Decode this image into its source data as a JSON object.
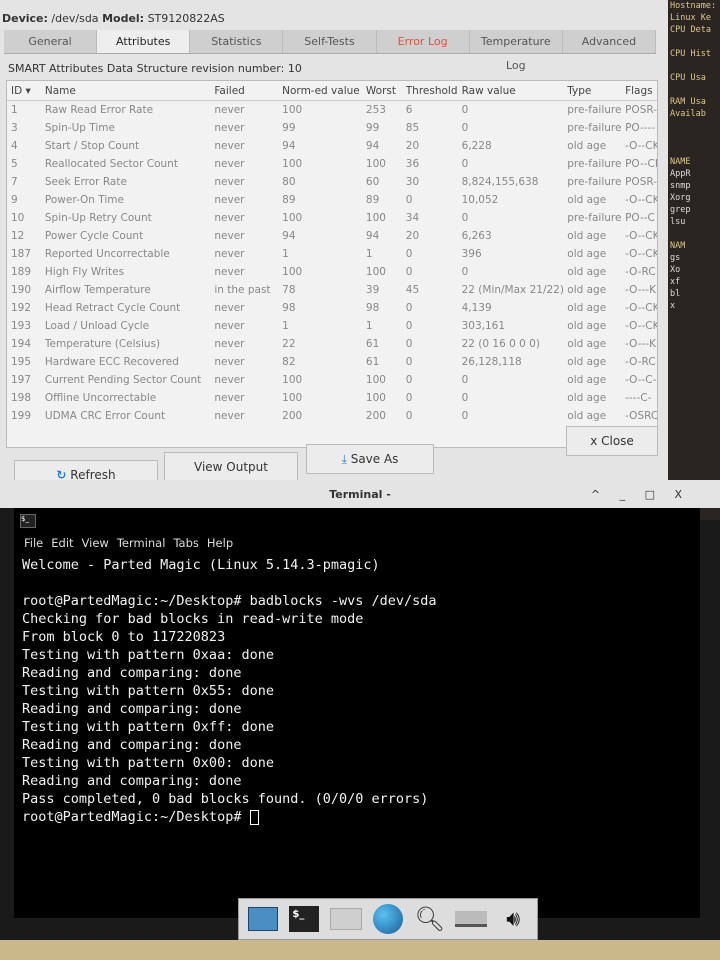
{
  "device": {
    "label": "Device:",
    "value": "/dev/sda",
    "model_label": "Model:",
    "model": "ST9120822AS"
  },
  "tabs": [
    "General",
    "Attributes",
    "Statistics",
    "Self-Tests",
    "Error Log",
    "Temperature Log",
    "Advanced"
  ],
  "revision": "SMART Attributes Data Structure revision number: 10",
  "columns": [
    "ID ▾",
    "Name",
    "Failed",
    "Norm-ed value",
    "Worst",
    "Threshold",
    "Raw value",
    "Type",
    "Flags"
  ],
  "rows": [
    [
      "1",
      "Raw Read Error Rate",
      "never",
      "100",
      "253",
      "6",
      "0",
      "pre-failure",
      "POSR-"
    ],
    [
      "3",
      "Spin-Up Time",
      "never",
      "99",
      "99",
      "85",
      "0",
      "pre-failure",
      "PO----"
    ],
    [
      "4",
      "Start / Stop Count",
      "never",
      "94",
      "94",
      "20",
      "6,228",
      "old age",
      "-O--CK"
    ],
    [
      "5",
      "Reallocated Sector Count",
      "never",
      "100",
      "100",
      "36",
      "0",
      "pre-failure",
      "PO--CK"
    ],
    [
      "7",
      "Seek Error Rate",
      "never",
      "80",
      "60",
      "30",
      "8,824,155,638",
      "pre-failure",
      "POSR-"
    ],
    [
      "9",
      "Power-On Time",
      "never",
      "89",
      "89",
      "0",
      "10,052",
      "old age",
      "-O--CK"
    ],
    [
      "10",
      "Spin-Up Retry Count",
      "never",
      "100",
      "100",
      "34",
      "0",
      "pre-failure",
      "PO--C"
    ],
    [
      "12",
      "Power Cycle Count",
      "never",
      "94",
      "94",
      "20",
      "6,263",
      "old age",
      "-O--CK"
    ],
    [
      "187",
      "Reported Uncorrectable",
      "never",
      "1",
      "1",
      "0",
      "396",
      "old age",
      "-O--CK"
    ],
    [
      "189",
      "High Fly Writes",
      "never",
      "100",
      "100",
      "0",
      "0",
      "old age",
      "-O-RC"
    ],
    [
      "190",
      "Airflow Temperature",
      "in the past",
      "78",
      "39",
      "45",
      "22 (Min/Max 21/22)",
      "old age",
      "-O---K"
    ],
    [
      "192",
      "Head Retract Cycle Count",
      "never",
      "98",
      "98",
      "0",
      "4,139",
      "old age",
      "-O--CK"
    ],
    [
      "193",
      "Load / Unload Cycle",
      "never",
      "1",
      "1",
      "0",
      "303,161",
      "old age",
      "-O--CK"
    ],
    [
      "194",
      "Temperature (Celsius)",
      "never",
      "22",
      "61",
      "0",
      "22 (0 16 0 0 0)",
      "old age",
      "-O---K"
    ],
    [
      "195",
      "Hardware ECC Recovered",
      "never",
      "82",
      "61",
      "0",
      "26,128,118",
      "old age",
      "-O-RC"
    ],
    [
      "197",
      "Current Pending Sector Count",
      "never",
      "100",
      "100",
      "0",
      "0",
      "old age",
      "-O--C-"
    ],
    [
      "198",
      "Offline Uncorrectable",
      "never",
      "100",
      "100",
      "0",
      "0",
      "old age",
      "----C-"
    ],
    [
      "199",
      "UDMA CRC Error Count",
      "never",
      "200",
      "200",
      "0",
      "0",
      "old age",
      "-OSRC"
    ]
  ],
  "buttons": {
    "close": "x Close",
    "refresh": "Refresh",
    "view_output": "View Output",
    "save_as": "Save As"
  },
  "right_panel": [
    "Hostname:",
    "Linux Ke",
    "CPU Deta",
    "",
    "CPU Hist",
    "",
    "CPU Usa",
    "",
    "RAM Usa",
    "Availab",
    "",
    "",
    "",
    "NAME",
    "AppR",
    "snmp",
    "Xorg",
    "grep",
    "lsu",
    "",
    "NAM",
    "gs",
    "Xo",
    "xf",
    "bl",
    "x"
  ],
  "terminal": {
    "title": "Terminal -",
    "window_controls": "^ _ □ X",
    "menu": [
      "File",
      "Edit",
      "View",
      "Terminal",
      "Tabs",
      "Help"
    ],
    "lines": [
      "Welcome - Parted Magic (Linux 5.14.3-pmagic)",
      "",
      "root@PartedMagic:~/Desktop# badblocks -wvs /dev/sda",
      "Checking for bad blocks in read-write mode",
      "From block 0 to 117220823",
      "Testing with pattern 0xaa: done",
      "Reading and comparing: done",
      "Testing with pattern 0x55: done",
      "Reading and comparing: done",
      "Testing with pattern 0xff: done",
      "Reading and comparing: done",
      "Testing with pattern 0x00: done",
      "Reading and comparing: done",
      "Pass completed, 0 bad blocks found. (0/0/0 errors)"
    ],
    "prompt": "root@PartedMagic:~/Desktop# "
  },
  "taskbar": {
    "terminal_icon_text": "$_"
  }
}
